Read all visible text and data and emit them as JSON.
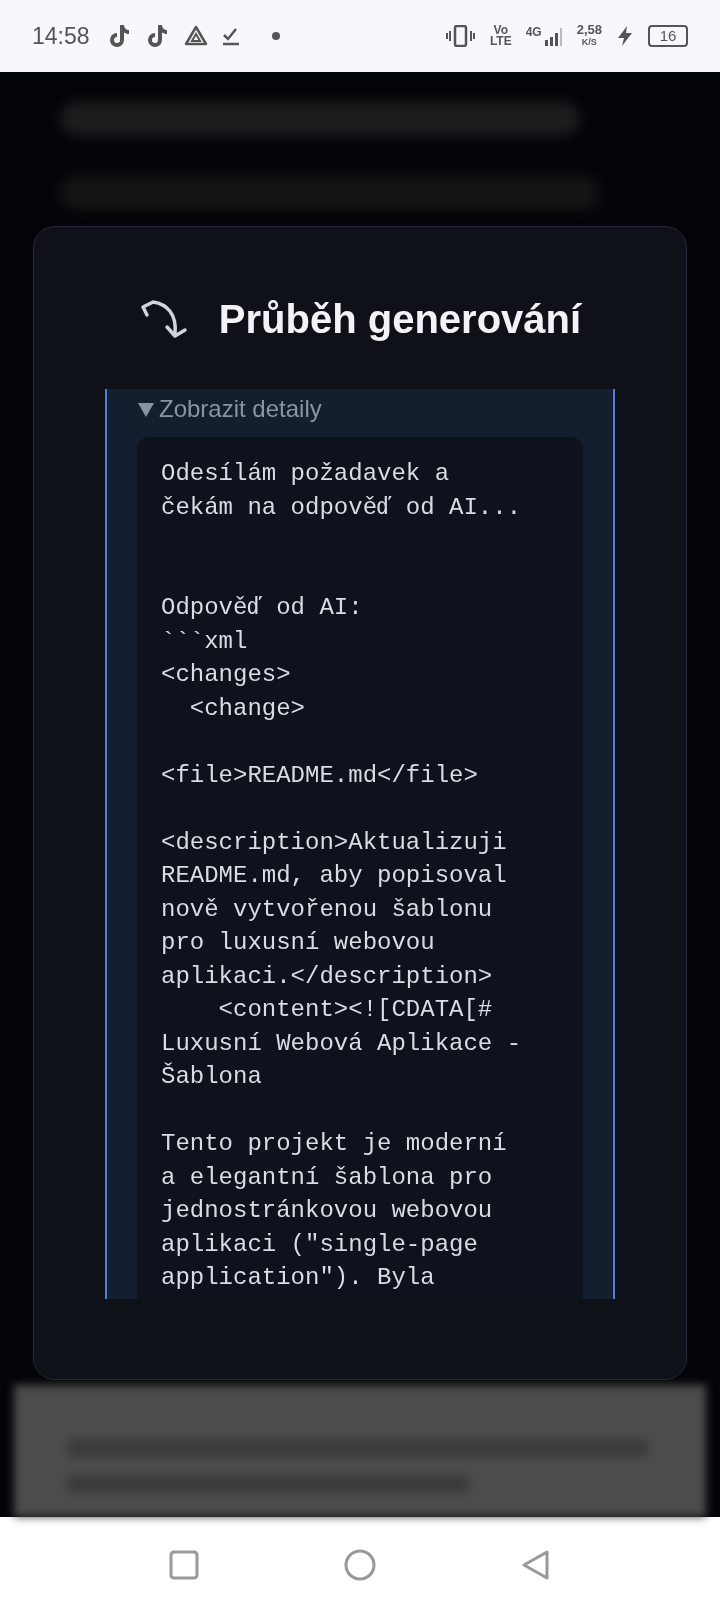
{
  "status_bar": {
    "time": "14:58",
    "volte": [
      "Vo",
      "LTE"
    ],
    "network": "4G",
    "speed": "2,58",
    "speed_unit": "K/S",
    "battery": "16"
  },
  "dialog": {
    "title": "Průběh generování",
    "details": {
      "label": "Zobrazit detaily",
      "expanded": true,
      "log": "Odesílám požadavek a\nčekám na odpověď od AI...\n\n\nOdpověď od AI:\n```xml\n<changes>\n  <change>\n\n<file>README.md</file>\n\n<description>Aktualizuji\nREADME.md, aby popisoval\nnově vytvořenou šablonu\npro luxusní webovou\naplikaci.</description>\n    <content><![CDATA[#\nLuxusní Webová Aplikace -\nŠablona\n\nTento projekt je moderní\na elegantní šablona pro\njednostránkovou webovou\naplikaci (\"single-page\napplication\"). Byla"
    }
  }
}
